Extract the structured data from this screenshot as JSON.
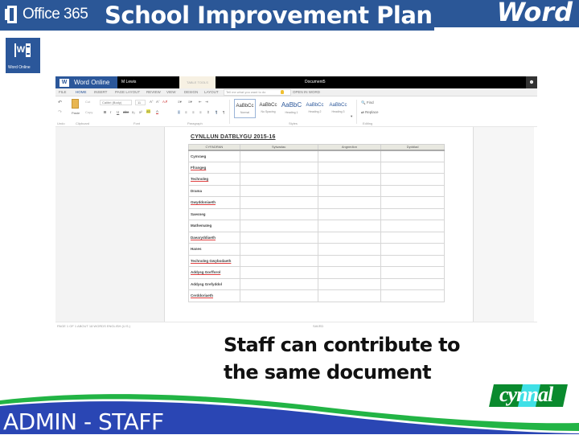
{
  "header": {
    "office_label": "Office 365",
    "title": "School Improvement Plan",
    "app_label": "Word"
  },
  "word_tile": {
    "label": "Word Online"
  },
  "word_online": {
    "app_name": "Word Online",
    "user_name": "M Lewis",
    "table_tools": "TABLE TOOLS",
    "document_name": "Document5",
    "tabs": [
      "FILE",
      "HOME",
      "INSERT",
      "PAGE LAYOUT",
      "REVIEW",
      "VIEW",
      "DESIGN",
      "LAYOUT"
    ],
    "active_tab": "HOME",
    "tell_me_placeholder": "Tell me what you want to do",
    "open_in_word": "OPEN IN WORD",
    "ribbon": {
      "paste_label": "Paste",
      "cut_label": "Cut",
      "copy_label": "Copy",
      "font_name": "Calibri (Body)",
      "font_size": "11",
      "groups": [
        "Undo",
        "Clipboard",
        "Font",
        "Paragraph",
        "Styles",
        "Editing"
      ],
      "styles": [
        {
          "sample": "AaBbCc",
          "name": "Normal"
        },
        {
          "sample": "AaBbCc",
          "name": "No Spacing"
        },
        {
          "sample": "AaBbC",
          "name": "Heading 1"
        },
        {
          "sample": "AaBbCc",
          "name": "Heading 2"
        },
        {
          "sample": "AaBbCc",
          "name": "Heading 3"
        }
      ],
      "find_label": "Find",
      "replace_label": "Replace"
    },
    "document": {
      "title": "CYNLLUN DATBLYGU 2015-16",
      "columns": [
        "CYFADRAN",
        "Sylwadau",
        "Angnedion",
        "Dyddiad"
      ],
      "rows": [
        "Cymraeg",
        "Ffrangeg",
        "Technoleg",
        "Drama",
        "Gwyddoniaeth",
        "Saesneg",
        "Mathemateg",
        "Daearyddiaeth",
        "Hanes",
        "Technoleg Gwybodaeth",
        "Addysg Gorfforol",
        "Addysg Grefyddol",
        "Cerddoriaeth"
      ]
    },
    "status_bar": {
      "left": "PAGE 1 OF 1    ABOUT 18 WORDS    ENGLISH (U.S.)",
      "middle": "SAVED"
    }
  },
  "caption": "Staff can contribute to the same document",
  "footer": {
    "label": "ADMIN - STAFF",
    "logo_text": "cynnal"
  },
  "colors": {
    "banner_blue": "#2b5797",
    "word_blue": "#2b579a",
    "swoosh_blue": "#2a46b4",
    "swoosh_green": "#22b445",
    "logo_green": "#0a8a2e",
    "logo_cyan": "#3fe0e6"
  }
}
